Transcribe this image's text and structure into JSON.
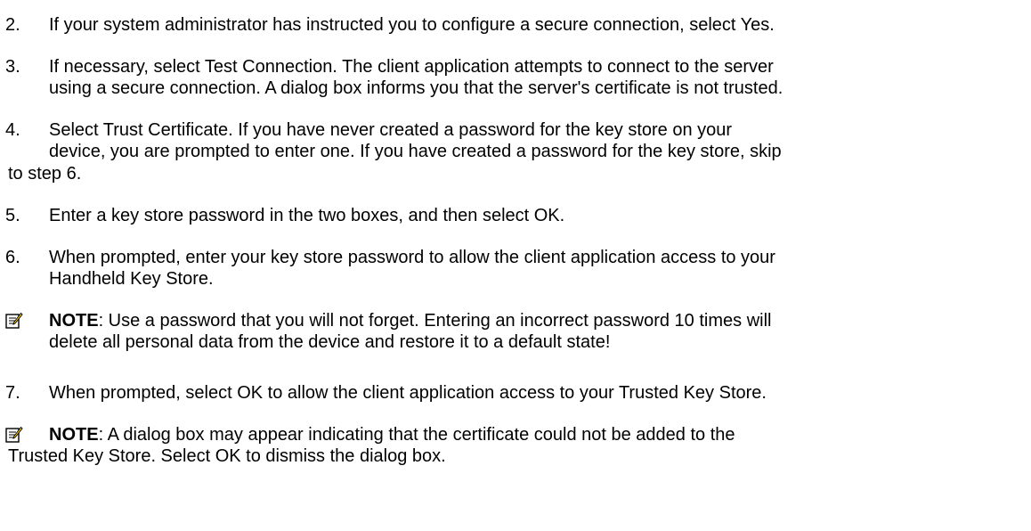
{
  "steps": [
    {
      "number": "2.",
      "text": "If your system administrator has instructed you to configure a secure connection, select Yes."
    },
    {
      "number": "3.",
      "line1": "If necessary, select Test Connection. The client application attempts to connect to the server",
      "line2": "using a secure connection. A dialog box informs you that the server's certificate is not trusted."
    },
    {
      "number": "4.",
      "line1": "Select Trust Certificate. If you have never created a password for the key store on your",
      "line2": "device, you are prompted to enter one. If you have created a password for the key store, skip",
      "line3": "to step 6."
    },
    {
      "number": "5.",
      "text": "Enter a key store password in the two boxes, and then select OK."
    },
    {
      "number": "6.",
      "line1": "When prompted, enter your key store password to allow the client application access to your",
      "line2": "Handheld Key Store."
    },
    {
      "number": "7.",
      "text": "When prompted, select OK to allow the client application access to your Trusted Key Store."
    }
  ],
  "notes": [
    {
      "icon": "note-icon",
      "label": "NOTE",
      "line1": ": Use a password that you will not forget. Entering an incorrect password 10 times will",
      "line2": "delete all personal data from the device and restore it to a default state!"
    },
    {
      "icon": "note-icon",
      "label": "NOTE",
      "line1": ": A dialog box may appear indicating that the certificate could not be added to the",
      "line2": "Trusted Key Store. Select OK to dismiss the dialog box."
    }
  ]
}
